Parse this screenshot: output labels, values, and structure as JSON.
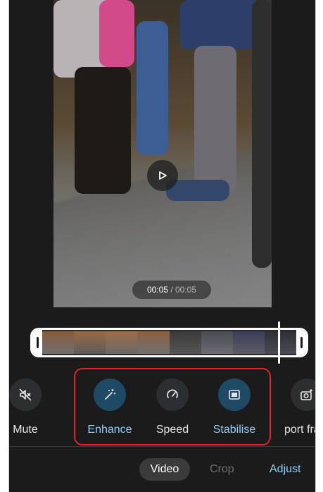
{
  "player": {
    "current_time": "00:05",
    "separator": " / ",
    "duration": "00:05",
    "play_icon": "play-icon"
  },
  "tools": [
    {
      "label": "Mute",
      "icon": "volume-off-icon",
      "active": false
    },
    {
      "label": "Enhance",
      "icon": "magic-wand-icon",
      "active": true
    },
    {
      "label": "Speed",
      "icon": "speedometer-icon",
      "active": false
    },
    {
      "label": "Stabilise",
      "icon": "stabilise-icon",
      "active": true
    },
    {
      "label": "port fram",
      "icon": "camera-add-icon",
      "active": false
    }
  ],
  "tabs": {
    "video": "Video",
    "crop": "Crop",
    "adjust": "Adjust"
  },
  "colors": {
    "accent": "#8fd0ff",
    "highlight": "#e0242c",
    "active_circle": "#1f4a66"
  }
}
